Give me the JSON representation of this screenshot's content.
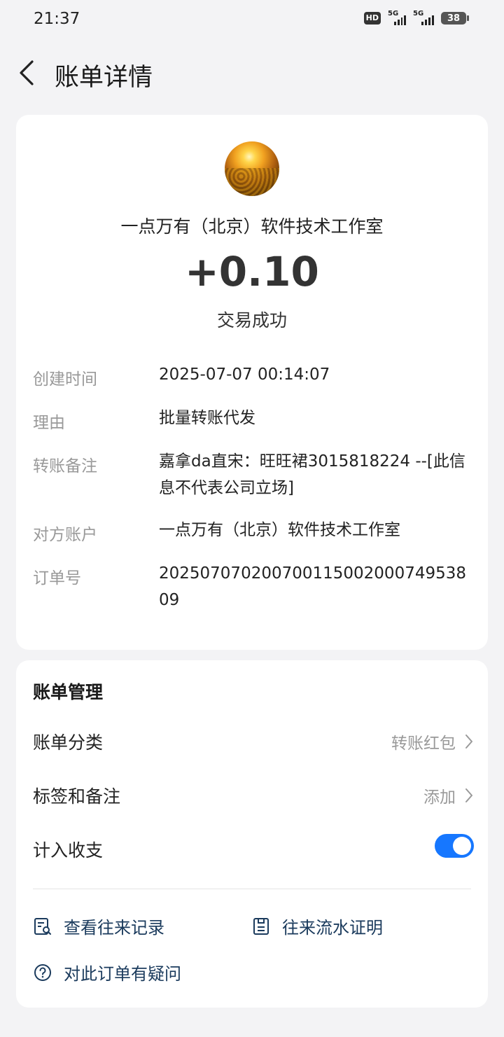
{
  "status_bar": {
    "time": "21:37",
    "hd_badge": "HD",
    "network_1": "5G",
    "network_2": "5G",
    "battery": "38"
  },
  "header": {
    "title": "账单详情"
  },
  "transaction": {
    "merchant": "一点万有（北京）软件技术工作室",
    "amount": "+0.10",
    "status": "交易成功",
    "details": [
      {
        "label": "创建时间",
        "value": "2025-07-07 00:14:07"
      },
      {
        "label": "理由",
        "value": "批量转账代发"
      },
      {
        "label": "转账备注",
        "value": "嘉拿da直宋：旺旺裙3015818224 --[此信息不代表公司立场]"
      },
      {
        "label": "对方账户",
        "value": "一点万有（北京）软件技术工作室"
      },
      {
        "label": "订单号",
        "value": "20250707020070011500200074953809"
      }
    ]
  },
  "manage": {
    "title": "账单管理",
    "category_label": "账单分类",
    "category_value": "转账红包",
    "tags_label": "标签和备注",
    "tags_value": "添加",
    "include_label": "计入收支",
    "include_enabled": true,
    "actions": {
      "history": "查看往来记录",
      "proof": "往来流水证明",
      "question": "对此订单有疑问"
    }
  },
  "colors": {
    "accent": "#1677ff",
    "background": "#f3f3f5",
    "label_gray": "#999999"
  }
}
